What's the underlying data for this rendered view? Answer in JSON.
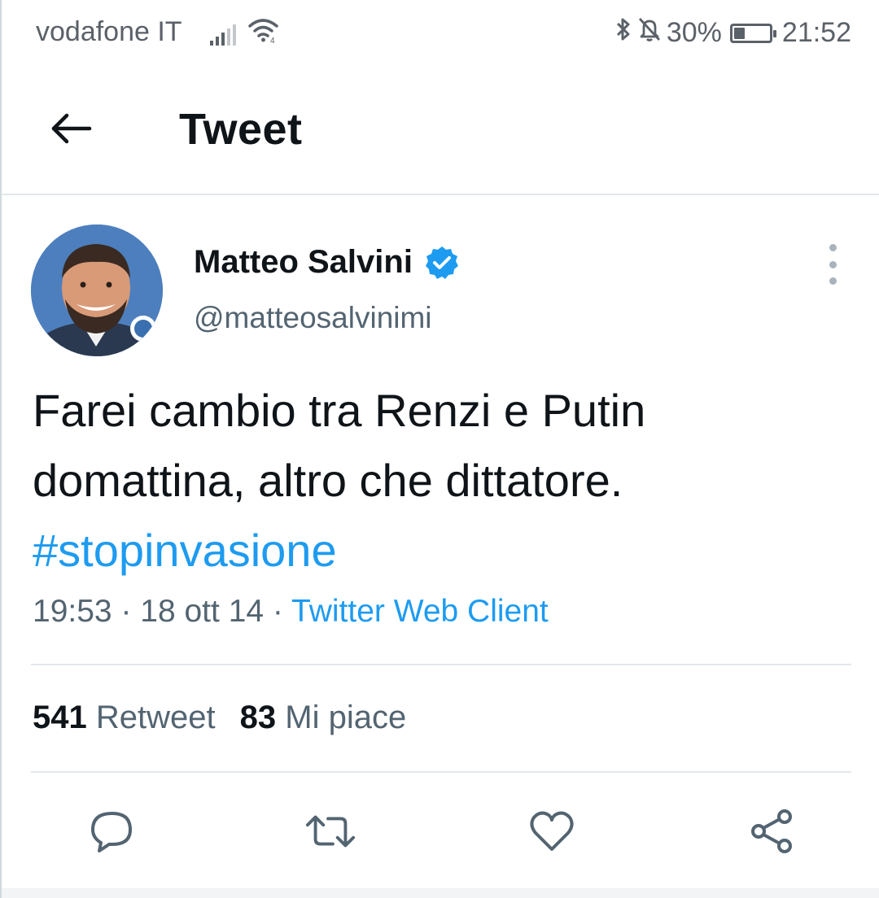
{
  "status_bar": {
    "carrier": "vodafone IT",
    "battery_percent": "30%",
    "battery_level": 0.3,
    "time": "21:52",
    "icons": [
      "signal-icon",
      "wifi-icon",
      "bluetooth-icon",
      "bell-off-icon",
      "battery-icon"
    ]
  },
  "header": {
    "title": "Tweet",
    "back_icon": "arrow-left-icon"
  },
  "tweet": {
    "author_name": "Matteo Salvini",
    "author_handle": "@matteosalvinimi",
    "verified": true,
    "text_line_1": "Farei cambio tra Renzi e Putin",
    "text_line_2": "domattina, altro che dittatore.",
    "hashtag": "#stopinvasione",
    "time": "19:53",
    "sep1": " · ",
    "date": "18 ott 14",
    "sep2": " · ",
    "source": "Twitter Web Client",
    "retweet_count": "541",
    "retweet_label": "Retweet",
    "like_count": "83",
    "like_label": "Mi piace"
  },
  "colors": {
    "accent": "#1d9bf0",
    "text_primary": "#0f1419",
    "text_secondary": "#536471",
    "divider": "#e3e7ea"
  },
  "actions": [
    "reply-icon",
    "retweet-icon",
    "like-icon",
    "share-icon"
  ]
}
